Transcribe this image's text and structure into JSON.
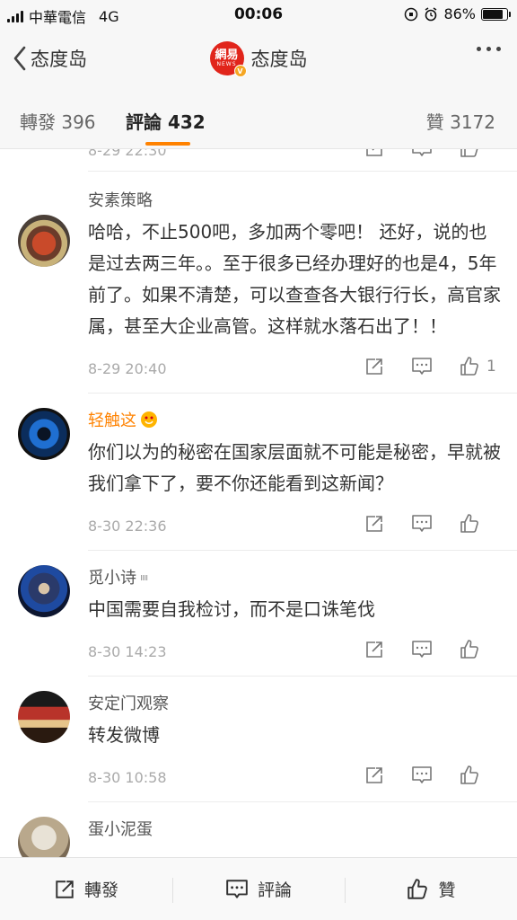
{
  "status_bar": {
    "carrier": "中華電信",
    "network": "4G",
    "time": "00:06",
    "battery": "86%",
    "battery_level": 0.86
  },
  "nav": {
    "back_label": "态度岛",
    "title": "态度岛",
    "logo_text": "網易",
    "logo_sub": "NEWS"
  },
  "tabs": {
    "repost": "轉發 396",
    "comment": "評論 432",
    "like": "贊 3172"
  },
  "comments": [
    {
      "name": "",
      "text": "",
      "date": "8-29 22:30",
      "likes": ""
    },
    {
      "name": "安素策略",
      "text": "哈哈，不止500吧，多加两个零吧！ 还好，说的也是过去两三年。。至于很多已经办理好的也是4，5年前了。如果不清楚，可以查查各大银行行长，高官家属，甚至大企业高管。这样就水落石出了！！",
      "date": "8-29 20:40",
      "likes": "1"
    },
    {
      "name": "轻触这",
      "text": "你们以为的秘密在国家层面就不可能是秘密，早就被我们拿下了，要不你还能看到这新闻？",
      "date": "8-30 22:36",
      "likes": ""
    },
    {
      "name": "觅小诗",
      "text": "中国需要自我检讨，而不是口诛笔伐",
      "date": "8-30 14:23",
      "likes": ""
    },
    {
      "name": "安定门观察",
      "text": "转发微博",
      "date": "8-30 10:58",
      "likes": ""
    },
    {
      "name": "蛋小泥蛋",
      "text": "",
      "date": "",
      "likes": ""
    }
  ],
  "bottom_bar": {
    "repost": "轉發",
    "comment": "評論",
    "like": "贊"
  },
  "colors": {
    "accent": "#ff8200",
    "brand_red": "#e1251b"
  }
}
